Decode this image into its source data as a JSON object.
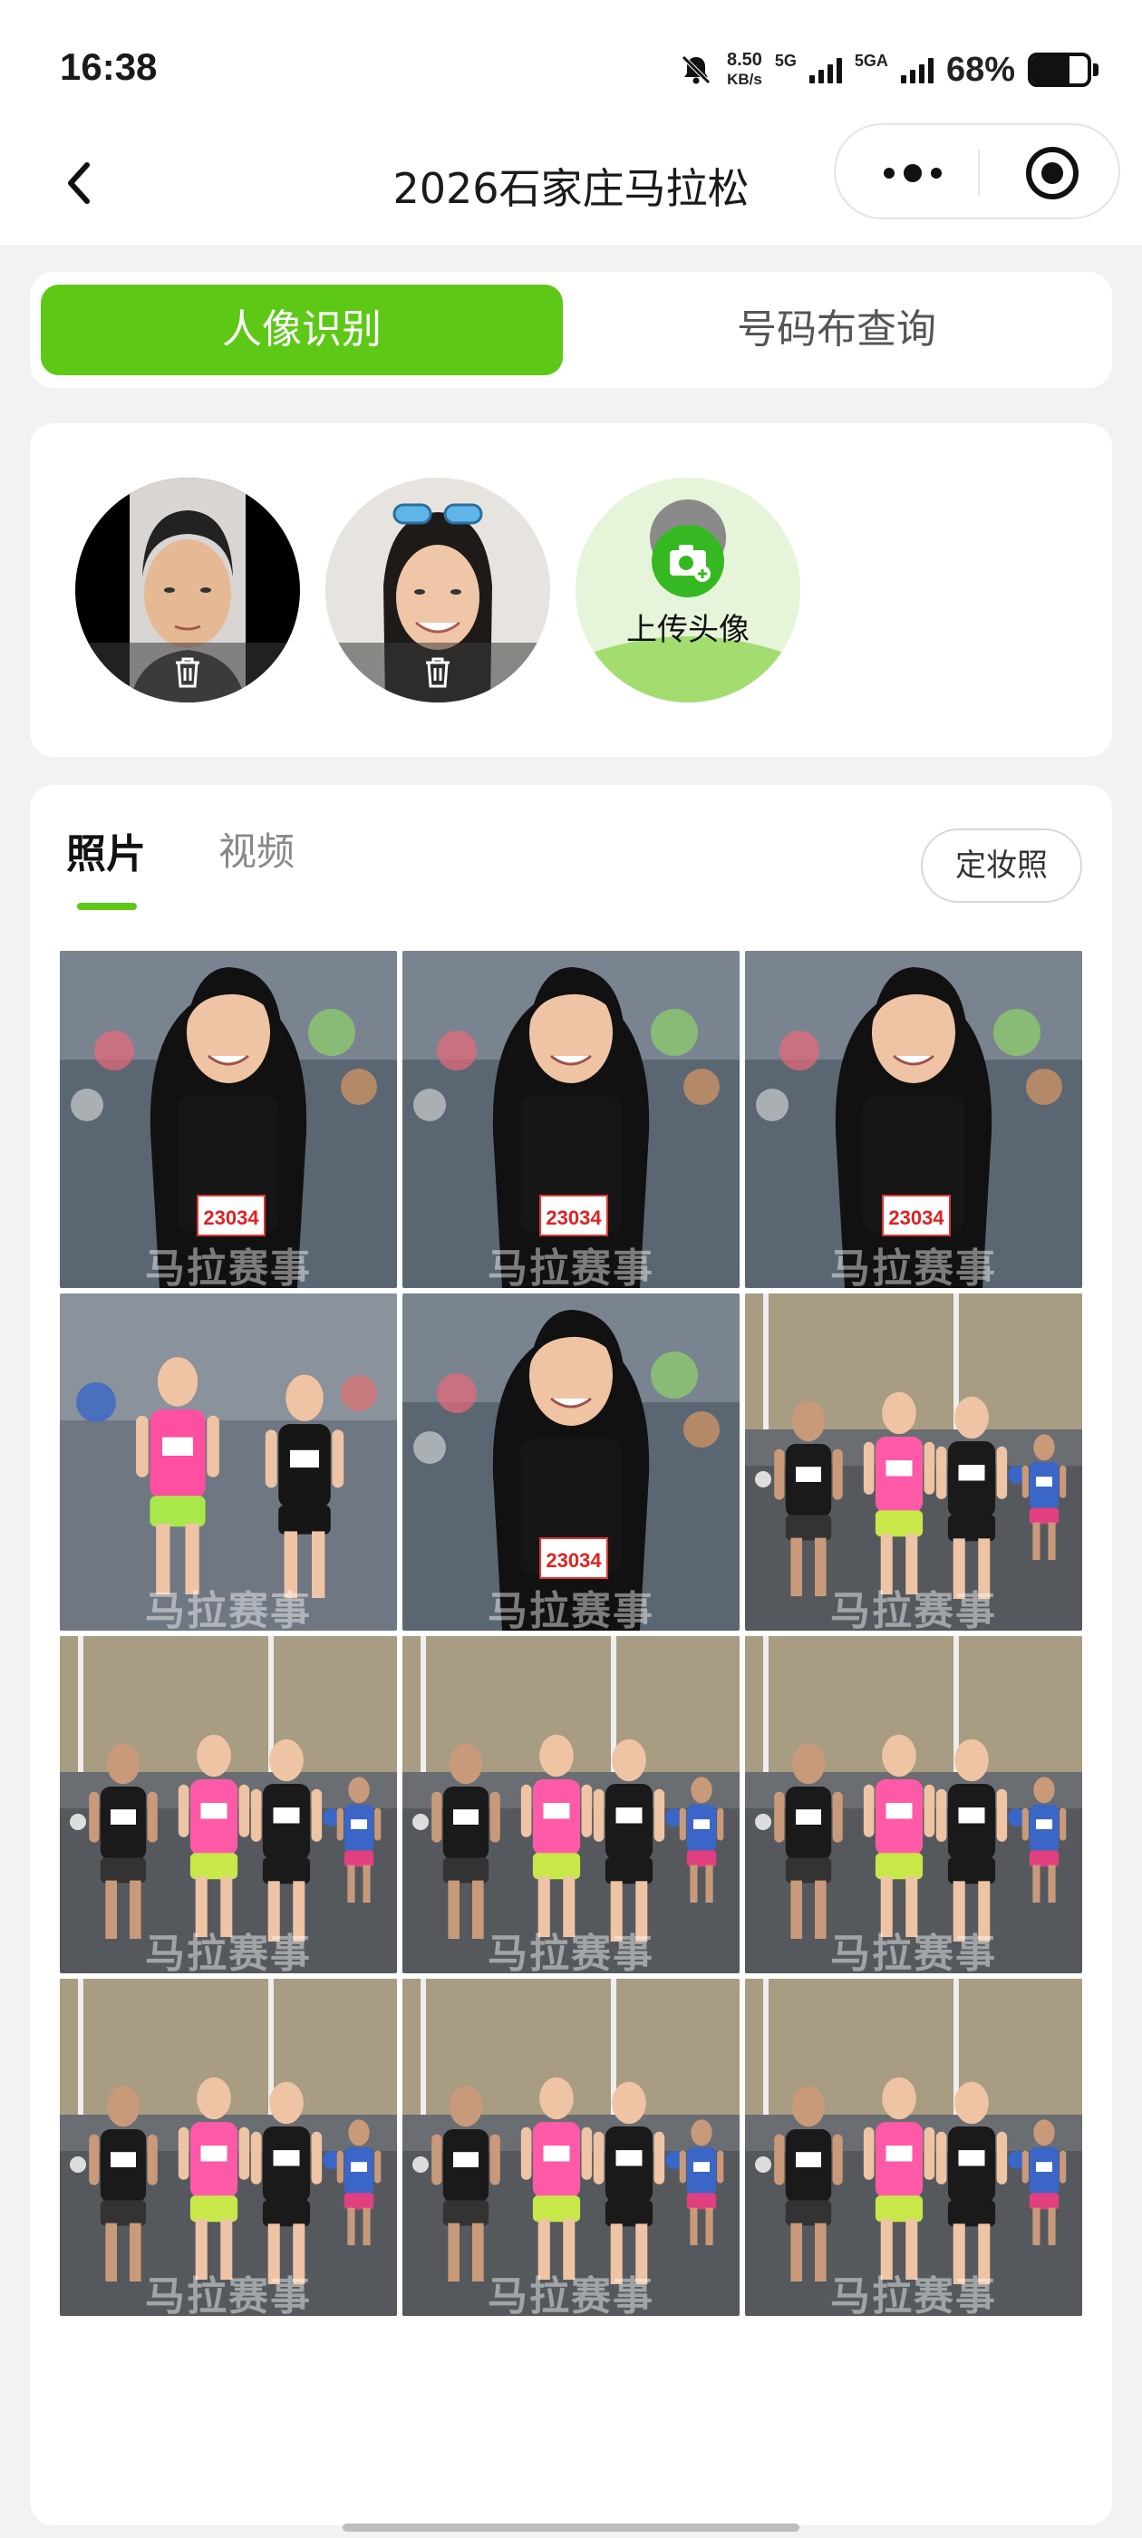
{
  "status_bar": {
    "time": "16:38",
    "net_speed_value": "8.50",
    "net_speed_unit": "KB/s",
    "signal1_label": "5G",
    "signal2_label": "5GA",
    "battery_percent": "68%",
    "battery_level": 0.68
  },
  "header": {
    "title": "2026石家庄马拉松",
    "back_icon": "chevron-left-icon",
    "more_icon": "more-dots-icon",
    "record_icon": "target-circle-icon"
  },
  "segment": {
    "active_label": "人像识别",
    "other_label": "号码布查询",
    "accent_color": "#5ec817"
  },
  "faces": {
    "items": [
      {
        "type": "face-photo",
        "delete_icon": "trash-icon"
      },
      {
        "type": "face-photo",
        "delete_icon": "trash-icon"
      }
    ],
    "upload_label": "上传头像",
    "upload_icon": "camera-plus-icon"
  },
  "media": {
    "tabs": [
      {
        "label": "照片",
        "active": true
      },
      {
        "label": "视频",
        "active": false
      }
    ],
    "makeup_button": "定妆照",
    "watermark": "马拉赛事",
    "photos": [
      {
        "scene": "closeup"
      },
      {
        "scene": "closeup"
      },
      {
        "scene": "closeup"
      },
      {
        "scene": "duo"
      },
      {
        "scene": "closeup"
      },
      {
        "scene": "group"
      },
      {
        "scene": "group"
      },
      {
        "scene": "group"
      },
      {
        "scene": "group"
      },
      {
        "scene": "group"
      },
      {
        "scene": "group"
      },
      {
        "scene": "group"
      }
    ]
  }
}
